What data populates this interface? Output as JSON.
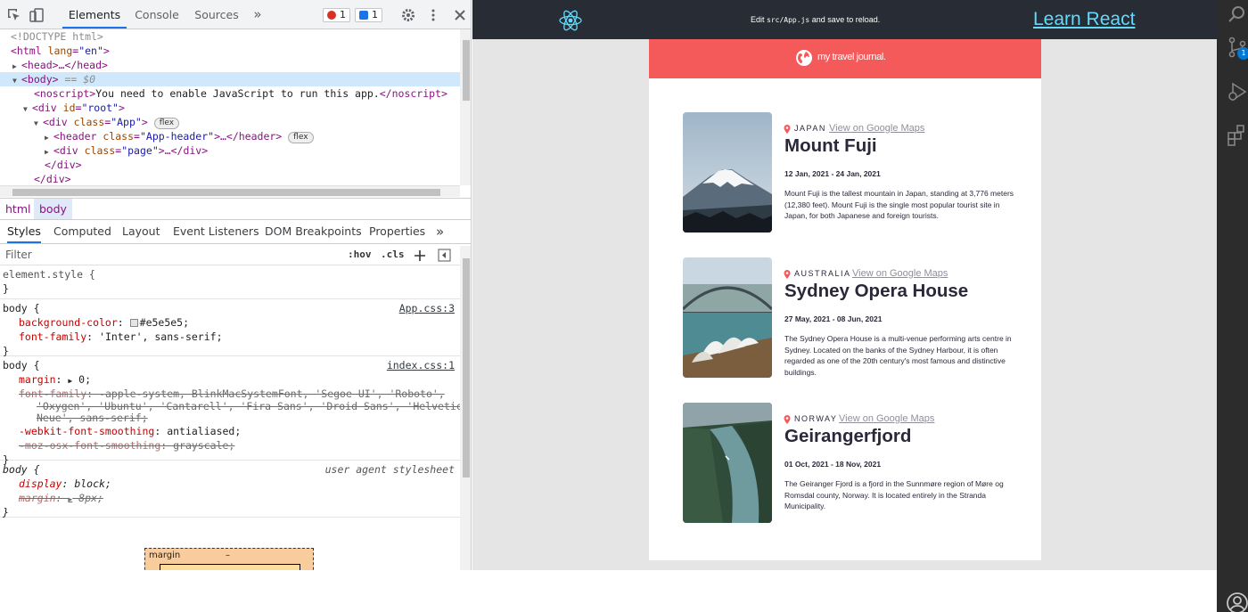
{
  "devtools": {
    "tabs": [
      "Elements",
      "Console",
      "Sources"
    ],
    "more_tabs": "»",
    "error_count": "1",
    "message_count": "1",
    "dom": {
      "doctype": "<!DOCTYPE html>",
      "html_open_tag": "<html",
      "html_attr_name": "lang",
      "html_attr_value": "\"en\"",
      "head_line": "<head>…</head>",
      "body_tag": "<body>",
      "body_suffix": "== $0",
      "noscript_open": "<noscript>",
      "noscript_text": "You need to enable JavaScript to run this app.",
      "noscript_close": "</noscript>",
      "root_div_tag": "<div",
      "root_attr": "id",
      "root_value": "\"root\"",
      "app_div_tag": "<div",
      "app_attr": "class",
      "app_value": "\"App\"",
      "flex_pill": "flex",
      "header_tag": "<header",
      "header_attr": "class",
      "header_value": "\"App-header\"",
      "header_close": ">…</header>",
      "page_tag": "<div",
      "page_attr": "class",
      "page_value": "\"page\"",
      "page_close": ">…</div>",
      "div_close": "</div>"
    },
    "breadcrumbs": [
      "html",
      "body"
    ],
    "style_tabs": [
      "Styles",
      "Computed",
      "Layout",
      "Event Listeners",
      "DOM Breakpoints",
      "Properties"
    ],
    "filter_placeholder": "Filter",
    "hov": ":hov",
    "cls": ".cls",
    "rules": {
      "element_style": "element.style {",
      "close": "}",
      "body_selector": "body {",
      "app_css_source": "App.css:3",
      "index_css_source": "index.css:1",
      "ua_source": "user agent stylesheet",
      "app_props": [
        {
          "name": "background-color",
          "value": "#e5e5e5;"
        },
        {
          "name": "font-family",
          "value": "'Inter', sans-serif;"
        }
      ],
      "index_props": {
        "margin_name": "margin",
        "margin_value": "0;",
        "font_family_name": "font-family",
        "font_family_value_1": "-apple-system, BlinkMacSystemFont, 'Segoe UI', 'Roboto',",
        "font_family_value_2": "'Oxygen', 'Ubuntu', 'Cantarell', 'Fira Sans', 'Droid Sans', 'Helvetica",
        "font_family_value_3": "Neue', sans-serif;",
        "smoothing_name": "-webkit-font-smoothing",
        "smoothing_value": "antialiased;",
        "moz_name": "-moz-osx-font-smoothing",
        "moz_value": "grayscale;"
      },
      "ua_props": {
        "display_name": "display",
        "display_value": "block;",
        "margin_name": "margin",
        "margin_value": "8px;"
      }
    },
    "box_model": {
      "label": "margin",
      "value": "–"
    }
  },
  "app": {
    "edit_prefix": "Edit ",
    "edit_code": "src/App.js",
    "edit_suffix": " and save to reload.",
    "learn_link": "Learn React",
    "journal_title": "my travel journal.",
    "maps_link": "View on Google Maps",
    "entries": [
      {
        "country": "JAPAN",
        "title": "Mount Fuji",
        "dates": "12 Jan, 2021 - 24 Jan, 2021",
        "description": "Mount Fuji is the tallest mountain in Japan, standing at 3,776 meters (12,380 feet). Mount Fuji is the single most popular tourist site in Japan, for both Japanese and foreign tourists."
      },
      {
        "country": "AUSTRALIA",
        "title": "Sydney Opera House",
        "dates": "27 May, 2021 - 08 Jun, 2021",
        "description": "The Sydney Opera House is a multi-venue performing arts centre in Sydney. Located on the banks of the Sydney Harbour, it is often regarded as one of the 20th century's most famous and distinctive buildings."
      },
      {
        "country": "NORWAY",
        "title": "Geirangerfjord",
        "dates": "01 Oct, 2021 - 18 Nov, 2021",
        "description": "The Geiranger Fjord is a fjord in the Sunnmøre region of Møre og Romsdal county, Norway. It is located entirely in the Stranda Municipality."
      }
    ]
  },
  "activity_bar": {
    "badge": "1",
    "icons": [
      "search-icon",
      "source-control-icon",
      "run-debug-icon",
      "extensions-icon",
      "account-icon"
    ]
  },
  "colors": {
    "journal_accent": "#f55a5a",
    "react_blue": "#61dafb",
    "page_bg": "#e5e5e5",
    "header_bg": "#282c34"
  }
}
